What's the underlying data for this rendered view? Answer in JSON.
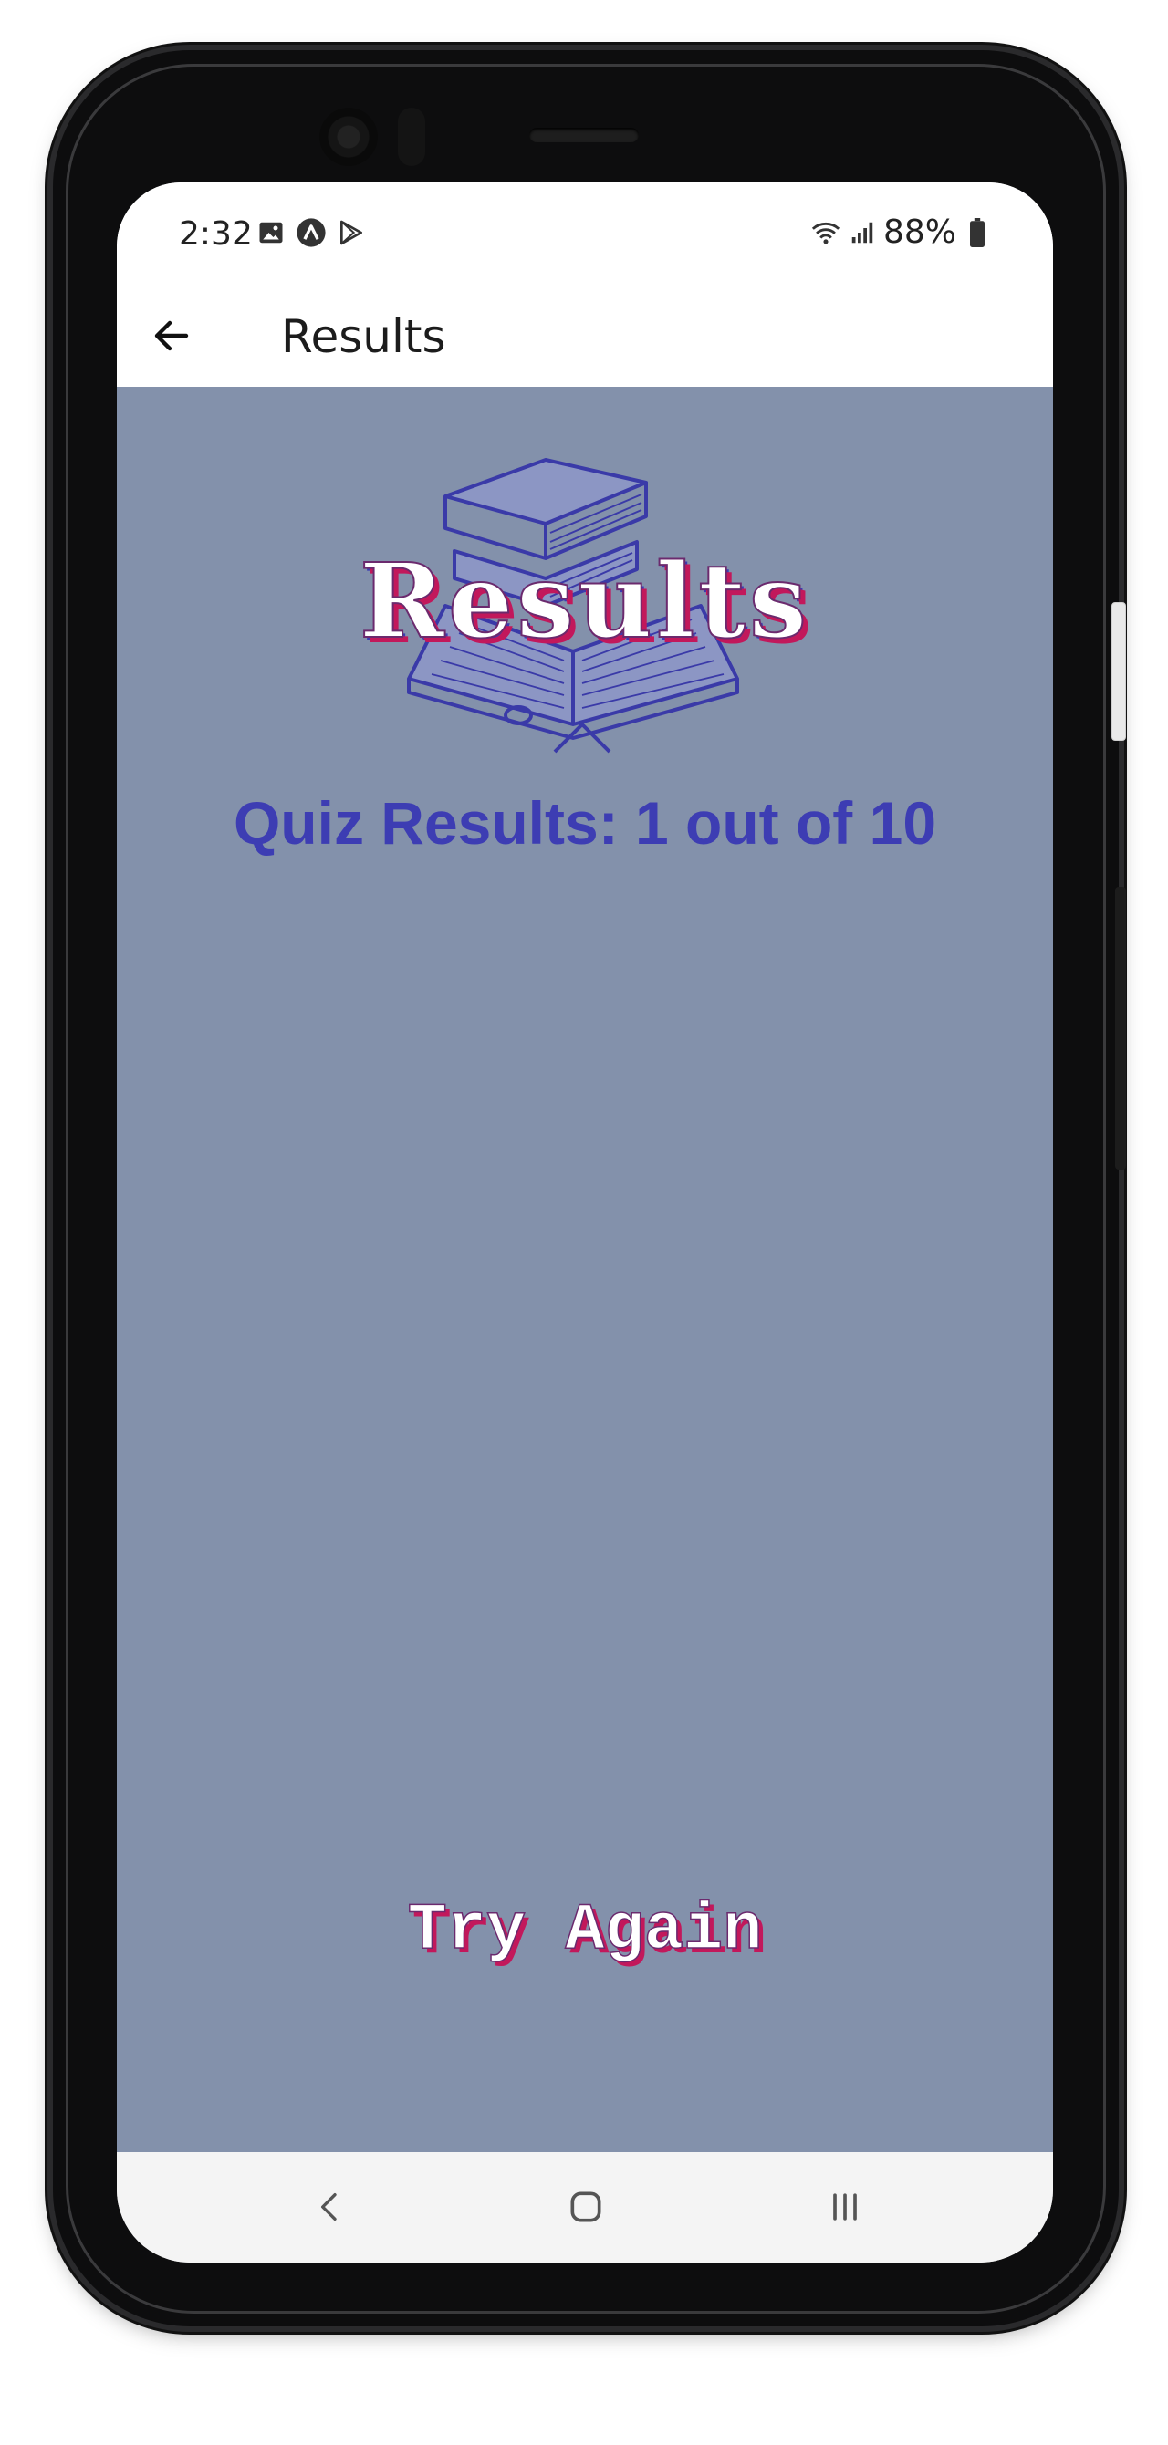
{
  "status_bar": {
    "time": "2:32",
    "battery": "88%",
    "icons_left": [
      "gallery-icon",
      "app-a-icon",
      "play-store-icon"
    ],
    "icons_right": [
      "wifi-icon",
      "signal-icon",
      "battery-icon"
    ]
  },
  "app_bar": {
    "title": "Results"
  },
  "content": {
    "background_color": "#8391ab",
    "logo_text": "Results",
    "score_text": "Quiz Results: 1 out of 10",
    "try_again_label": "Try Again"
  },
  "nav_bar": {
    "buttons": [
      "back-nav-icon",
      "home-nav-icon",
      "recents-nav-icon"
    ]
  },
  "colors": {
    "accent": "#3d3db3",
    "text_shadow": "#c2185b"
  }
}
